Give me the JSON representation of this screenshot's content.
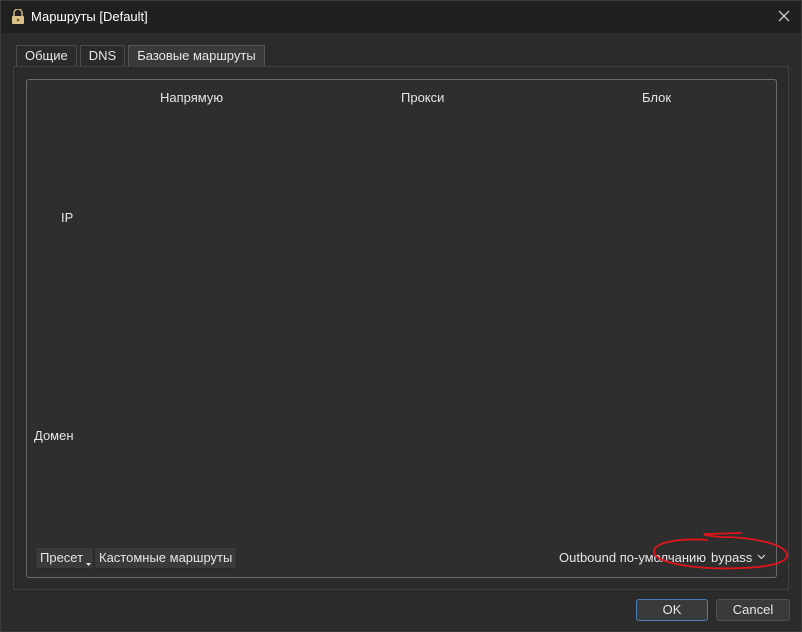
{
  "window": {
    "title": "Маршруты [Default]"
  },
  "tabs": [
    {
      "label": "Общие"
    },
    {
      "label": "DNS"
    },
    {
      "label": "Базовые маршруты"
    }
  ],
  "active_tab": "Базовые маршруты",
  "grid": {
    "columns": [
      "Напрямую",
      "Прокси",
      "Блок"
    ],
    "rows": [
      "IP",
      "Домен"
    ]
  },
  "bottom": {
    "preset_label": "Пресет",
    "custom_routes_label": "Кастомные маршруты",
    "outbound_label": "Outbound по-умолчанию",
    "outbound_value": "bypass"
  },
  "footer": {
    "ok_label": "OK",
    "cancel_label": "Cancel"
  },
  "colors": {
    "background": "#2b2b2b",
    "annotation": "#e0151b",
    "primary_border": "#4a7fb8"
  },
  "icons": [
    "app-icon",
    "close-icon",
    "dropdown-caret-icon",
    "chevron-down-icon"
  ]
}
